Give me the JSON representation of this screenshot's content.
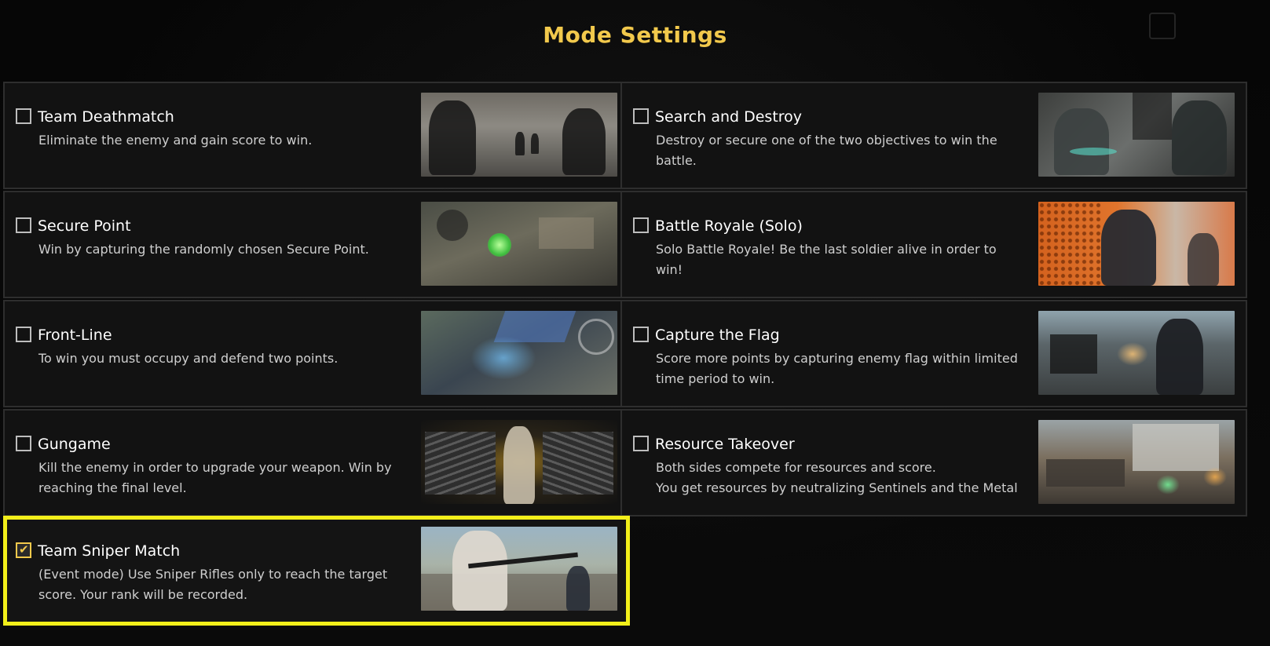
{
  "page": {
    "title": "Mode Settings"
  },
  "colors": {
    "accent": "#f2c94c",
    "selected_border": "#f2ef1a",
    "card_bg": "#121212",
    "card_border": "#2e2e2e"
  },
  "modes": [
    {
      "name": "Team Deathmatch",
      "desc": "Eliminate the enemy and gain score to win.",
      "checked": false,
      "thumb_icon": "soldiers-street-image"
    },
    {
      "name": "Search and Destroy",
      "desc": "Destroy or secure one of the two objectives to win the battle.",
      "checked": false,
      "thumb_icon": "armored-soldiers-image"
    },
    {
      "name": "Secure Point",
      "desc": "Win by capturing the randomly chosen Secure Point.",
      "checked": false,
      "thumb_icon": "aerial-map-image"
    },
    {
      "name": "Battle Royale (Solo)",
      "desc": "Solo Battle Royale! Be the last soldier alive in order to win!",
      "checked": false,
      "thumb_icon": "soldier-orange-wall-image"
    },
    {
      "name": "Front-Line",
      "desc": "To win you must occupy and defend two points.",
      "checked": false,
      "thumb_icon": "aerial-battle-image"
    },
    {
      "name": "Capture the Flag",
      "desc": "Score more points by capturing enemy flag within limited time period to win.",
      "checked": false,
      "thumb_icon": "subway-soldier-image"
    },
    {
      "name": "Gungame",
      "desc": "Kill the enemy in order to upgrade your weapon. Win by reaching the final level.",
      "checked": false,
      "thumb_icon": "weapons-character-image"
    },
    {
      "name": "Resource Takeover",
      "desc": "Both sides compete for resources and score.\nYou get resources by neutralizing Sentinels and the Metal",
      "checked": false,
      "thumb_icon": "industrial-battle-image"
    },
    {
      "name": "Team Sniper Match",
      "desc": "(Event mode) Use Sniper Rifles only to reach the target score. Your rank will be recorded.",
      "checked": true,
      "thumb_icon": "sniper-character-image"
    }
  ]
}
